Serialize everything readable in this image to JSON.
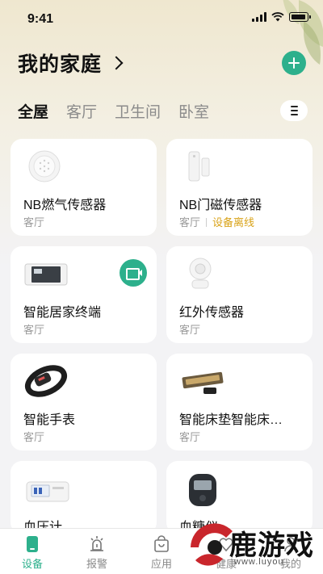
{
  "status": {
    "time": "9:41"
  },
  "header": {
    "title": "我的家庭"
  },
  "tabs": [
    {
      "label": "全屋",
      "active": true
    },
    {
      "label": "客厅",
      "active": false
    },
    {
      "label": "卫生间",
      "active": false
    },
    {
      "label": "卧室",
      "active": false
    }
  ],
  "devices": [
    {
      "name": "NB燃气传感器",
      "room": "客厅",
      "status": ""
    },
    {
      "name": "NB门磁传感器",
      "room": "客厅",
      "status": "设备离线"
    },
    {
      "name": "智能居家终端",
      "room": "客厅",
      "status": ""
    },
    {
      "name": "红外传感器",
      "room": "客厅",
      "status": ""
    },
    {
      "name": "智能手表",
      "room": "客厅",
      "status": ""
    },
    {
      "name": "智能床垫智能床…",
      "room": "客厅",
      "status": ""
    },
    {
      "name": "血压计",
      "room": "",
      "status": ""
    },
    {
      "name": "血糖仪",
      "room": "",
      "status": ""
    }
  ],
  "bottom_nav": [
    {
      "label": "设备",
      "icon": "device-icon",
      "active": true
    },
    {
      "label": "报警",
      "icon": "alarm-icon",
      "active": false
    },
    {
      "label": "应用",
      "icon": "app-bag-icon",
      "active": false
    },
    {
      "label": "健康",
      "icon": "health-icon",
      "active": false
    },
    {
      "label": "我的",
      "icon": "profile-icon",
      "active": false
    }
  ],
  "watermark": {
    "text": "鹿游戏",
    "url": "www.luyou"
  },
  "colors": {
    "accent": "#2db08c",
    "offline": "#d9a319"
  }
}
